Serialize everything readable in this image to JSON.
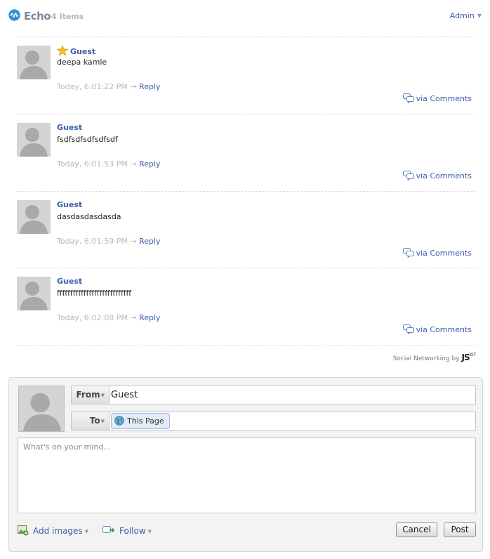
{
  "header": {
    "app_title": "Echo",
    "item_count": "4 Items",
    "admin_label": "Admin"
  },
  "comments": [
    {
      "author": "Guest",
      "text": "deepa kamle",
      "time": "Today, 6:01:22 PM",
      "reply_label": "Reply",
      "via_label": "via Comments",
      "starred": true
    },
    {
      "author": "Guest",
      "text": "fsdfsdfsdfsdfsdf",
      "time": "Today, 6:01:53 PM",
      "reply_label": "Reply",
      "via_label": "via Comments",
      "starred": false
    },
    {
      "author": "Guest",
      "text": "dasdasdasdasda",
      "time": "Today, 6:01:59 PM",
      "reply_label": "Reply",
      "via_label": "via Comments",
      "starred": false
    },
    {
      "author": "Guest",
      "text": "ffffffffffffffffffffffffffff",
      "time": "Today, 6:02:08 PM",
      "reply_label": "Reply",
      "via_label": "via Comments",
      "starred": false
    }
  ],
  "powered_by": {
    "text": "Social Networking by",
    "brand": "JS",
    "brand_sup": "KIT"
  },
  "composer": {
    "from_label": "From",
    "from_value": "Guest",
    "to_label": "To",
    "to_value": "This Page",
    "placeholder": "What's on your mind...",
    "add_images_label": "Add images",
    "follow_label": "Follow",
    "cancel_label": "Cancel",
    "post_label": "Post"
  },
  "colors": {
    "link": "#3b5fa8",
    "muted": "#b9b9b9",
    "panel_bg": "#f3f3f3"
  }
}
